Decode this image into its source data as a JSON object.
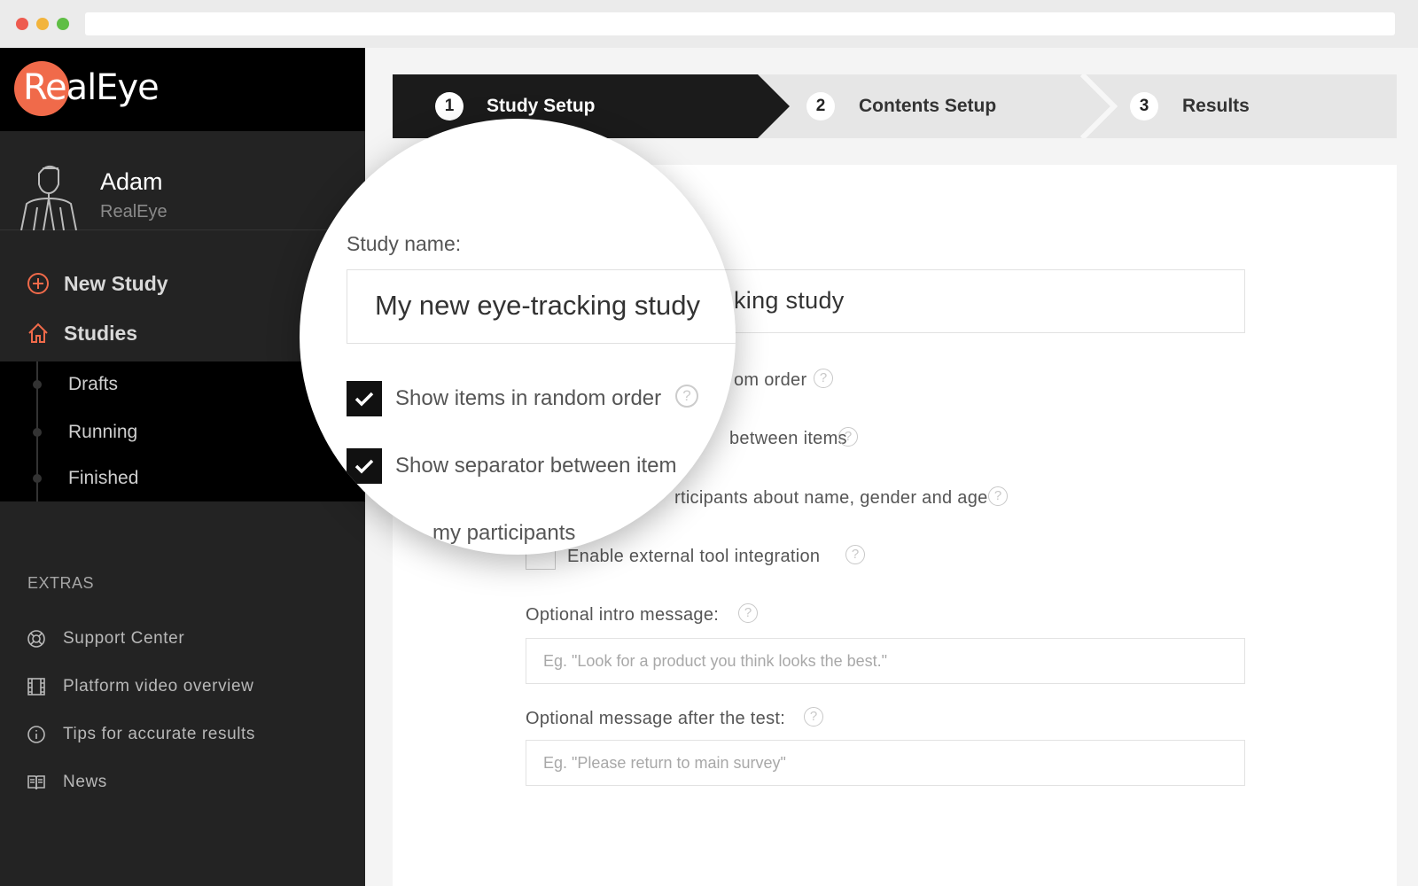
{
  "brand": {
    "logo_text": "RealEye",
    "accent": "#f06a4a"
  },
  "user": {
    "name": "Adam",
    "org": "RealEye"
  },
  "nav": {
    "new_study": "New Study",
    "studies": "Studies",
    "sub_items": [
      "Drafts",
      "Running",
      "Finished"
    ]
  },
  "extras": {
    "title": "EXTRAS",
    "items": [
      {
        "label": "Support Center",
        "icon": "lifebuoy-icon"
      },
      {
        "label": "Platform video overview",
        "icon": "film-icon"
      },
      {
        "label": "Tips for accurate results",
        "icon": "info-icon"
      },
      {
        "label": "News",
        "icon": "book-icon"
      }
    ]
  },
  "stepper": {
    "steps": [
      {
        "num": "1",
        "label": "Study Setup",
        "active": true
      },
      {
        "num": "2",
        "label": "Contents Setup",
        "active": false
      },
      {
        "num": "3",
        "label": "Results",
        "active": false
      }
    ]
  },
  "form": {
    "study_name_value_partial": "king study",
    "random_order_partial": "om order",
    "separator_partial": "between items",
    "ask_participants_partial": "rticipants about name, gender and age",
    "external_tool_label": "Enable external tool integration",
    "intro_label": "Optional intro message:",
    "intro_placeholder": "Eg. \"Look for a product you think looks the best.\"",
    "after_label": "Optional message after the test:",
    "after_placeholder": "Eg. \"Please return to main survey\"",
    "help_glyph": "?"
  },
  "magnifier": {
    "study_name_label": "Study name:",
    "study_name_value": "My new eye-tracking study",
    "random_order_label": "Show items in random order",
    "separator_label": "Show separator between item",
    "participants_partial": "my participants"
  }
}
